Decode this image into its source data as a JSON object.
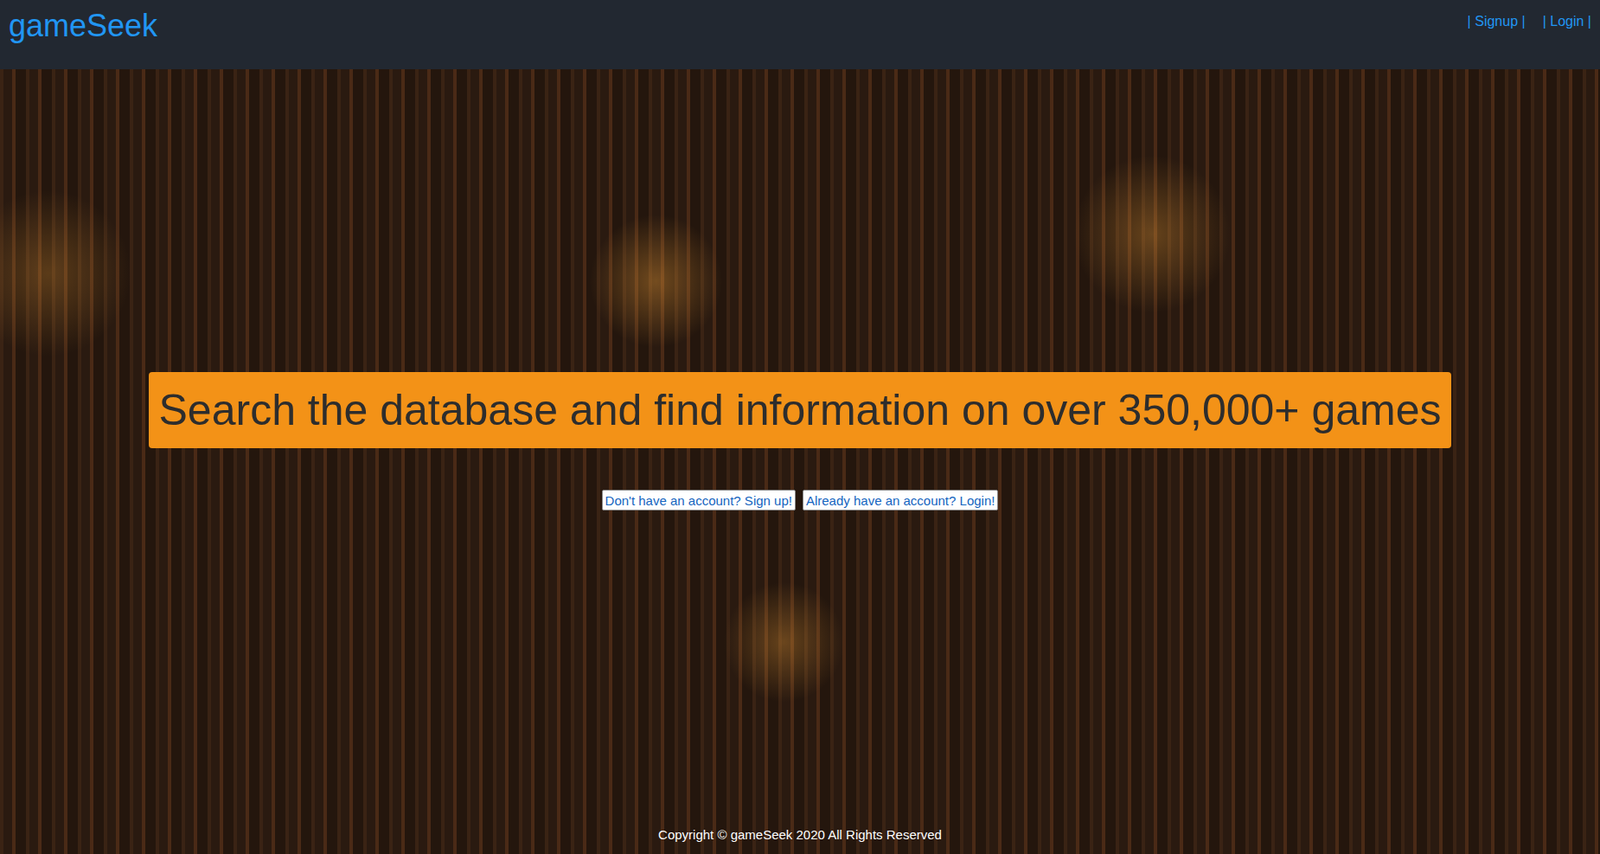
{
  "navbar": {
    "brand": "gameSeek",
    "links": [
      "| Signup |",
      "| Login |"
    ]
  },
  "hero": {
    "headline": "Search the database and find information on over 350,000+ games",
    "buttons": [
      "Don't have an account? Sign up!",
      "Already have an account? Login!"
    ]
  },
  "footer": {
    "copyright": "Copyright © gameSeek 2020 All Rights Reserved"
  }
}
